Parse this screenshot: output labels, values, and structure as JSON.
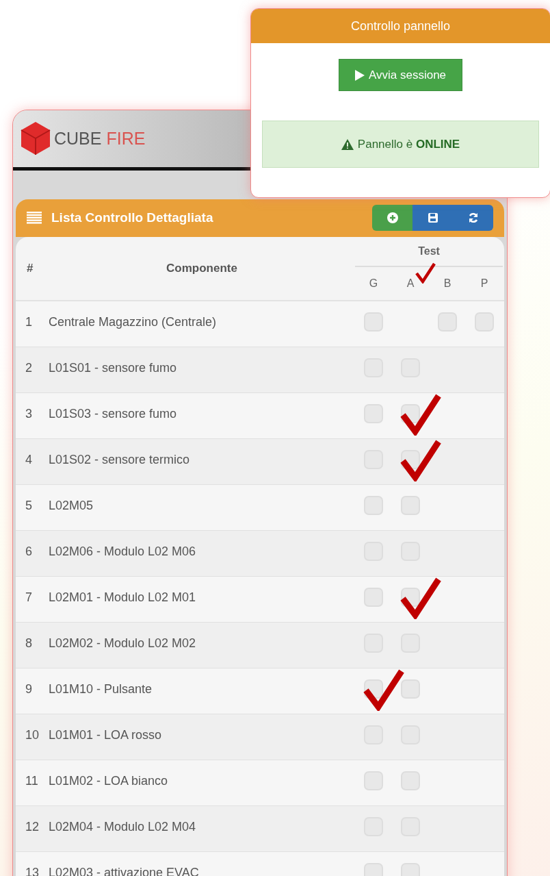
{
  "app": {
    "logo_left": "CUBE",
    "logo_right": "FIRE"
  },
  "popup": {
    "title": "Controllo pannello",
    "button": "Avvia sessione",
    "status_prefix": "Pannello è ",
    "status_value": "ONLINE"
  },
  "panel": {
    "title": "Lista Controllo Dettagliata",
    "actions": [
      {
        "kind": "add",
        "color": "#4aa04a"
      },
      {
        "kind": "save",
        "color": "#2f6fb5"
      },
      {
        "kind": "refresh",
        "color": "#2f6fb5"
      }
    ]
  },
  "table": {
    "col_index": "#",
    "col_component": "Componente",
    "group": "Test",
    "test_columns": [
      {
        "label": "G"
      },
      {
        "label": "A",
        "checked": true
      },
      {
        "label": "B"
      },
      {
        "label": "P"
      }
    ],
    "rows": [
      {
        "n": "1",
        "name": "Centrale Magazzino (Centrale)",
        "boxes": [
          {
            "kind": "box",
            "checked": false
          },
          {
            "kind": "none"
          },
          {
            "kind": "box",
            "checked": false
          },
          {
            "kind": "box",
            "checked": false
          }
        ]
      },
      {
        "n": "2",
        "name": "L01S01 - sensore fumo",
        "boxes": [
          {
            "kind": "box",
            "checked": false
          },
          {
            "kind": "box",
            "checked": false
          }
        ]
      },
      {
        "n": "3",
        "name": "L01S03 - sensore fumo",
        "boxes": [
          {
            "kind": "box",
            "checked": false
          },
          {
            "kind": "box",
            "checked": true
          }
        ]
      },
      {
        "n": "4",
        "name": "L01S02 - sensore termico",
        "boxes": [
          {
            "kind": "box",
            "checked": false
          },
          {
            "kind": "box",
            "checked": true
          }
        ]
      },
      {
        "n": "5",
        "name": "L02M05",
        "boxes": [
          {
            "kind": "box",
            "checked": false
          },
          {
            "kind": "box",
            "checked": false
          }
        ]
      },
      {
        "n": "6",
        "name": "L02M06 - Modulo L02 M06",
        "boxes": [
          {
            "kind": "box",
            "checked": false
          },
          {
            "kind": "box",
            "checked": false
          }
        ]
      },
      {
        "n": "7",
        "name": "L02M01 - Modulo L02 M01",
        "boxes": [
          {
            "kind": "box",
            "checked": false
          },
          {
            "kind": "box",
            "checked": true
          }
        ]
      },
      {
        "n": "8",
        "name": "L02M02 - Modulo L02 M02",
        "boxes": [
          {
            "kind": "box",
            "checked": false
          },
          {
            "kind": "box",
            "checked": false
          }
        ]
      },
      {
        "n": "9",
        "name": "L01M10 - Pulsante",
        "boxes": [
          {
            "kind": "box",
            "checked": true
          },
          {
            "kind": "box",
            "checked": false
          }
        ]
      },
      {
        "n": "10",
        "name": "L01M01 - LOA rosso",
        "boxes": [
          {
            "kind": "box",
            "checked": false
          },
          {
            "kind": "box",
            "checked": false
          }
        ]
      },
      {
        "n": "11",
        "name": "L01M02 - LOA bianco",
        "boxes": [
          {
            "kind": "box",
            "checked": false
          },
          {
            "kind": "box",
            "checked": false
          }
        ]
      },
      {
        "n": "12",
        "name": "L02M04 - Modulo L02 M04",
        "boxes": [
          {
            "kind": "box",
            "checked": false
          },
          {
            "kind": "box",
            "checked": false
          }
        ]
      },
      {
        "n": "13",
        "name": "L02M03 - attivazione EVAC",
        "boxes": [
          {
            "kind": "box",
            "checked": false
          },
          {
            "kind": "box",
            "checked": false
          }
        ]
      }
    ]
  }
}
